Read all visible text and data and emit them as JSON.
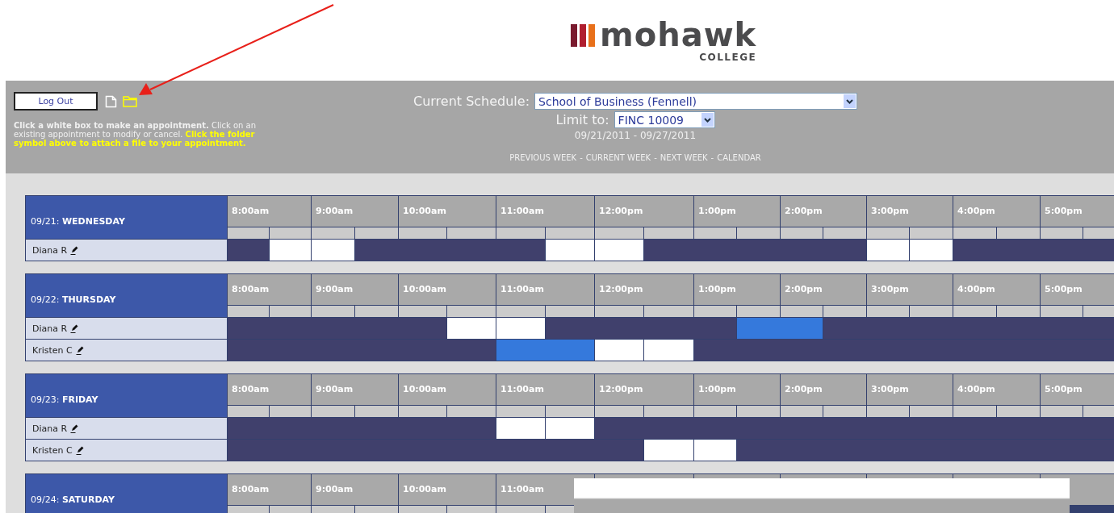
{
  "logo": {
    "wordmark": "mohawk",
    "subtitle": "COLLEGE"
  },
  "header": {
    "logout_button": "Log Out",
    "instructions": [
      {
        "text": "Click a white box to make an appointment.",
        "bold": true,
        "highlight": false
      },
      {
        "text": " Click on an existing appointment to modify or cancel. ",
        "bold": false,
        "highlight": false
      },
      {
        "text": "Click the folder symbol above to attach a file to your appointment.",
        "bold": true,
        "highlight": true
      }
    ],
    "schedule_label": "Current Schedule:",
    "schedule_value": "School of Business (Fennell)",
    "limit_label": "Limit to:",
    "limit_value": "FINC 10009",
    "date_range": "09/21/2011 - 09/27/2011",
    "nav_links": [
      "PREVIOUS WEEK",
      "CURRENT WEEK",
      "NEXT WEEK",
      "CALENDAR"
    ],
    "nav_separator": "-"
  },
  "days": [
    {
      "label": "09/21: **WEDNESDAY**",
      "hours": [
        "8:00am",
        "9:00am",
        "10:00am",
        "11:00am",
        "12:00pm",
        "1:00pm",
        "2:00pm",
        "3:00pm",
        "4:00pm",
        "5:00pm"
      ],
      "people": [
        {
          "name": "Diana R",
          "slots": [
            {
              "kind": "booked"
            },
            {
              "kind": "open"
            },
            {
              "kind": "open"
            },
            {
              "kind": "booked"
            },
            {
              "kind": "booked"
            },
            {
              "kind": "booked"
            },
            {
              "kind": "booked"
            },
            {
              "kind": "open"
            },
            {
              "kind": "open"
            },
            {
              "kind": "booked"
            },
            {
              "kind": "booked"
            },
            {
              "kind": "booked"
            },
            {
              "kind": "booked"
            },
            {
              "kind": "booked"
            },
            {
              "kind": "open"
            },
            {
              "kind": "open"
            },
            {
              "kind": "booked"
            },
            {
              "kind": "booked"
            },
            {
              "kind": "booked"
            },
            {
              "kind": "booked"
            }
          ]
        }
      ]
    },
    {
      "label": "09/22: **THURSDAY**",
      "hours": [
        "8:00am",
        "9:00am",
        "10:00am",
        "11:00am",
        "12:00pm",
        "1:00pm",
        "2:00pm",
        "3:00pm",
        "4:00pm",
        "5:00pm"
      ],
      "people": [
        {
          "name": "Diana R",
          "slots": [
            {
              "kind": "booked"
            },
            {
              "kind": "booked"
            },
            {
              "kind": "booked"
            },
            {
              "kind": "booked"
            },
            {
              "kind": "booked"
            },
            {
              "kind": "open"
            },
            {
              "kind": "open"
            },
            {
              "kind": "booked"
            },
            {
              "kind": "booked"
            },
            {
              "kind": "booked"
            },
            {
              "kind": "booked"
            },
            {
              "kind": "mine"
            },
            {
              "kind": "mine"
            },
            {
              "kind": "booked"
            },
            {
              "kind": "booked"
            },
            {
              "kind": "booked"
            },
            {
              "kind": "booked"
            },
            {
              "kind": "booked"
            },
            {
              "kind": "booked"
            },
            {
              "kind": "booked"
            }
          ]
        },
        {
          "name": "Kristen C",
          "slots": [
            {
              "kind": "booked"
            },
            {
              "kind": "booked"
            },
            {
              "kind": "booked"
            },
            {
              "kind": "booked"
            },
            {
              "kind": "booked"
            },
            {
              "kind": "booked"
            },
            {
              "kind": "mine"
            },
            {
              "kind": "mine"
            },
            {
              "kind": "open"
            },
            {
              "kind": "open"
            },
            {
              "kind": "booked"
            },
            {
              "kind": "booked"
            },
            {
              "kind": "booked"
            },
            {
              "kind": "booked"
            },
            {
              "kind": "booked"
            },
            {
              "kind": "booked"
            },
            {
              "kind": "booked"
            },
            {
              "kind": "booked"
            },
            {
              "kind": "booked"
            },
            {
              "kind": "booked"
            }
          ]
        }
      ]
    },
    {
      "label": "09/23: **FRIDAY**",
      "hours": [
        "8:00am",
        "9:00am",
        "10:00am",
        "11:00am",
        "12:00pm",
        "1:00pm",
        "2:00pm",
        "3:00pm",
        "4:00pm",
        "5:00pm"
      ],
      "people": [
        {
          "name": "Diana R",
          "slots": [
            {
              "kind": "booked"
            },
            {
              "kind": "booked"
            },
            {
              "kind": "booked"
            },
            {
              "kind": "booked"
            },
            {
              "kind": "booked"
            },
            {
              "kind": "booked"
            },
            {
              "kind": "open"
            },
            {
              "kind": "open"
            },
            {
              "kind": "booked"
            },
            {
              "kind": "booked"
            },
            {
              "kind": "booked"
            },
            {
              "kind": "booked"
            },
            {
              "kind": "booked"
            },
            {
              "kind": "booked"
            },
            {
              "kind": "booked"
            },
            {
              "kind": "booked"
            },
            {
              "kind": "booked"
            },
            {
              "kind": "booked"
            },
            {
              "kind": "booked"
            },
            {
              "kind": "booked"
            }
          ]
        },
        {
          "name": "Kristen C",
          "slots": [
            {
              "kind": "booked"
            },
            {
              "kind": "booked"
            },
            {
              "kind": "booked"
            },
            {
              "kind": "booked"
            },
            {
              "kind": "booked"
            },
            {
              "kind": "booked"
            },
            {
              "kind": "booked"
            },
            {
              "kind": "booked"
            },
            {
              "kind": "booked"
            },
            {
              "kind": "open"
            },
            {
              "kind": "open"
            },
            {
              "kind": "booked"
            },
            {
              "kind": "booked"
            },
            {
              "kind": "booked"
            },
            {
              "kind": "booked"
            },
            {
              "kind": "booked"
            },
            {
              "kind": "booked"
            },
            {
              "kind": "booked"
            },
            {
              "kind": "booked"
            },
            {
              "kind": "booked"
            }
          ]
        }
      ]
    },
    {
      "label": "09/24: **SATURDAY**",
      "hours": [
        "8:00am",
        "9:00am",
        "10:00am",
        "11:00am"
      ]
    }
  ]
}
